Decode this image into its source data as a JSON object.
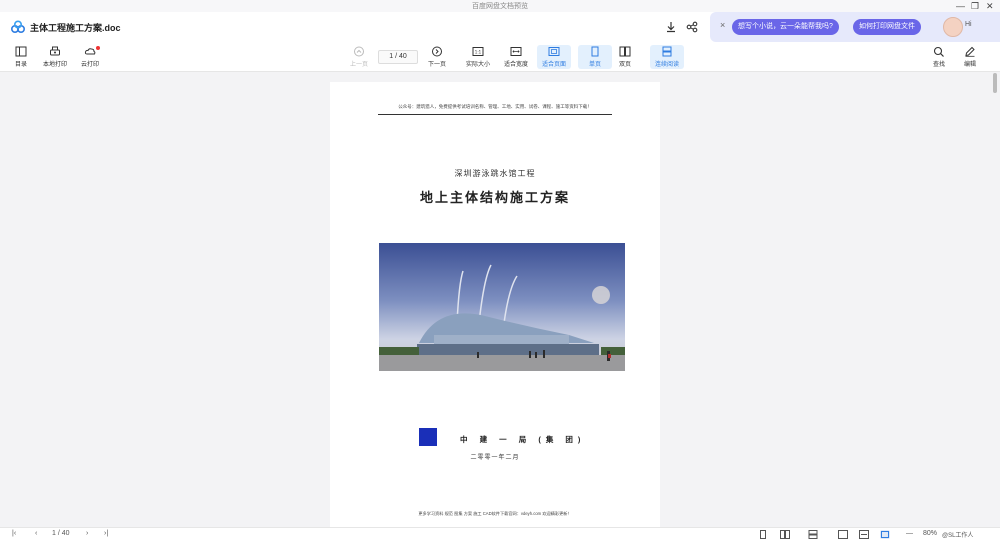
{
  "window": {
    "title": "百度网盘文档预览"
  },
  "header": {
    "doc_name": "主体工程施工方案.doc",
    "download_icon": "download-icon",
    "share_icon": "share-icon"
  },
  "ai_bar": {
    "suggestion_1": "想写个小说，云一朵能帮我吗?",
    "suggestion_2": "如何打印网盘文件",
    "greeting": "Hi"
  },
  "toolbar": {
    "toc": "目录",
    "local_print": "本地打印",
    "cloud_print": "云打印",
    "prev_page": "上一页",
    "page_indicator": "1 / 40",
    "next_page": "下一页",
    "actual_size": "实际大小",
    "fit_width": "适合宽度",
    "fit_page": "适合页面",
    "single_page": "单页",
    "double_page": "双页",
    "continuous": "连续阅读",
    "search": "查找",
    "edit": "编辑"
  },
  "document": {
    "header_line": "公众号：建筑猎人，免费提供考试培训名称、管理、工地、实用、试卷、课程、施工等资料下载！",
    "subtitle": "深圳游泳跳水馆工程",
    "title": "地上主体结构施工方案",
    "company": "中 建 一 局 (集 团)",
    "date": "二零零一年二月",
    "footer_line": "更多学习资料 规范 图集 方案 施工 CAD软件下载官网：vdeyh.com 欢迎精彩更新！"
  },
  "statusbar": {
    "page_indicator": "1 / 40",
    "zoom": "80%",
    "extra": "@SL工作人"
  },
  "colors": {
    "accent": "#2f7de1",
    "ai_pill": "#6a66e8",
    "ai_bg": "#e6e9fb",
    "logo_blue": "#1a2fb8"
  }
}
